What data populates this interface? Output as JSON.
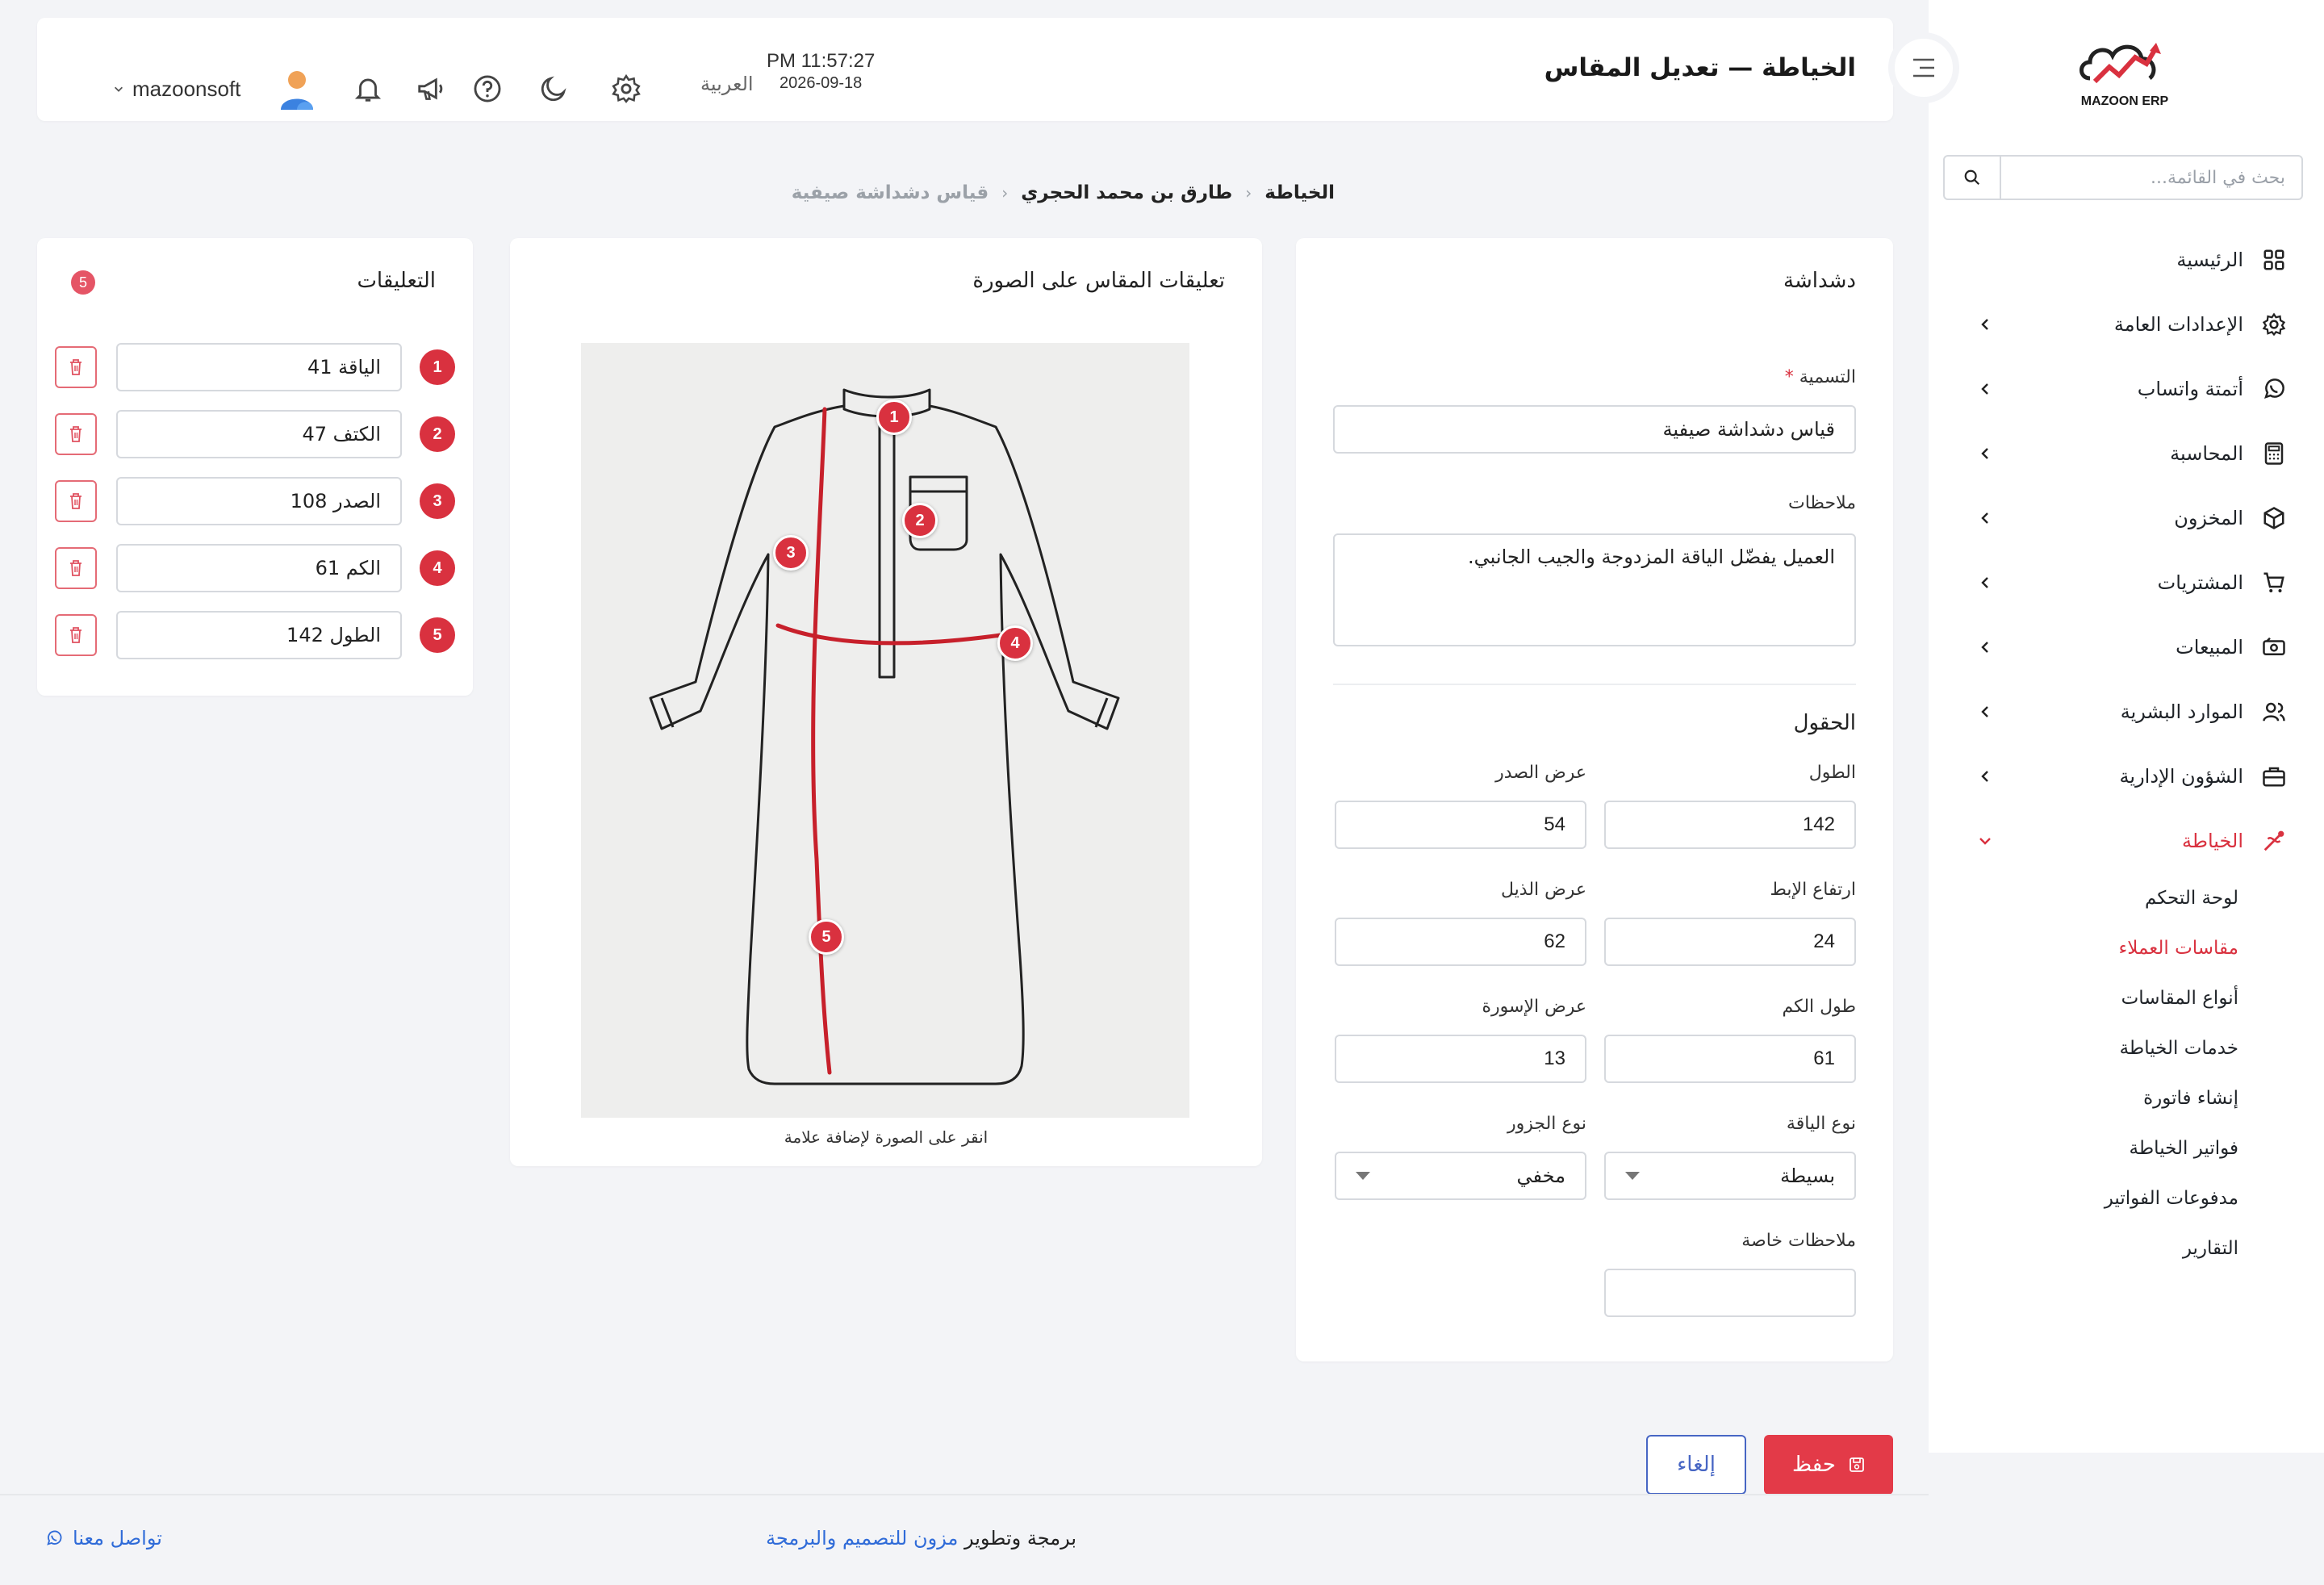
{
  "sidebar": {
    "logo_text": "MAZOON ERP",
    "search_placeholder": "بحث في القائمة...",
    "items": [
      {
        "label": "الرئيسية"
      },
      {
        "label": "الإعدادات العامة"
      },
      {
        "label": "أتمتة واتساب"
      },
      {
        "label": "المحاسبة"
      },
      {
        "label": "المخزون"
      },
      {
        "label": "المشتريات"
      },
      {
        "label": "المبيعات"
      },
      {
        "label": "الموارد البشرية"
      },
      {
        "label": "الشؤون الإدارية"
      },
      {
        "label": "الخياطة"
      }
    ],
    "subitems": [
      {
        "label": "لوحة التحكم"
      },
      {
        "label": "مقاسات العملاء"
      },
      {
        "label": "أنواع المقاسات"
      },
      {
        "label": "خدمات الخياطة"
      },
      {
        "label": "إنشاء فاتورة"
      },
      {
        "label": "فواتير الخياطة"
      },
      {
        "label": "مدفوعات الفواتير"
      },
      {
        "label": "التقارير"
      }
    ]
  },
  "header": {
    "title": "الخياطة — تعديل المقاس",
    "time": "PM 11:57:27",
    "date": "2026-09-18",
    "language": "العربية",
    "username": "mazoonsoft"
  },
  "breadcrumb": [
    "الخياطة",
    "طارق بن محمد الحجري",
    "قياس دشداشة صيفية"
  ],
  "form": {
    "card_title": "دشداشة",
    "name_label": "التسمية",
    "name_required": "*",
    "name_value": "قياس دشداشة صيفية",
    "notes_label": "ملاحظات",
    "notes_value": "العميل يفضّل الياقة المزدوجة والجيب الجانبي.",
    "fields_title": "الحقول",
    "fields": {
      "length_label": "الطول",
      "length_value": "142",
      "chest_label": "عرض الصدر",
      "chest_value": "54",
      "armpit_label": "ارتفاع الإبط",
      "armpit_value": "24",
      "hem_label": "عرض الذيل",
      "hem_value": "62",
      "sleeve_label": "طول الكم",
      "sleeve_value": "61",
      "cuff_label": "عرض الإسورة",
      "cuff_value": "13",
      "collar_label": "نوع الياقة",
      "collar_value": "بسيطة",
      "pocket_label": "نوع الجزور",
      "pocket_value": "مخفي",
      "special_label": "ملاحظات خاصة",
      "special_value": ""
    }
  },
  "image_card": {
    "title": "تعليقات المقاس على الصورة",
    "caption": "انقر على الصورة لإضافة علامة",
    "markers": [
      "1",
      "2",
      "3",
      "4",
      "5"
    ]
  },
  "notes_card": {
    "title": "التعليقات",
    "count": "5",
    "notes": [
      {
        "num": "1",
        "text": "الياقة 41"
      },
      {
        "num": "2",
        "text": "الكتف 47"
      },
      {
        "num": "3",
        "text": "الصدر 108"
      },
      {
        "num": "4",
        "text": "الكم 61"
      },
      {
        "num": "5",
        "text": "الطول 142"
      }
    ]
  },
  "actions": {
    "save": "حفظ",
    "cancel": "إلغاء"
  },
  "footer": {
    "credit_prefix": "برمجة وتطوير",
    "credit_link": "مزون للتصميم والبرمجة",
    "contact": "تواصل معنا"
  },
  "colors": {
    "accent": "#d9313f",
    "link": "#2f6bd8",
    "cancel": "#4766c4"
  }
}
